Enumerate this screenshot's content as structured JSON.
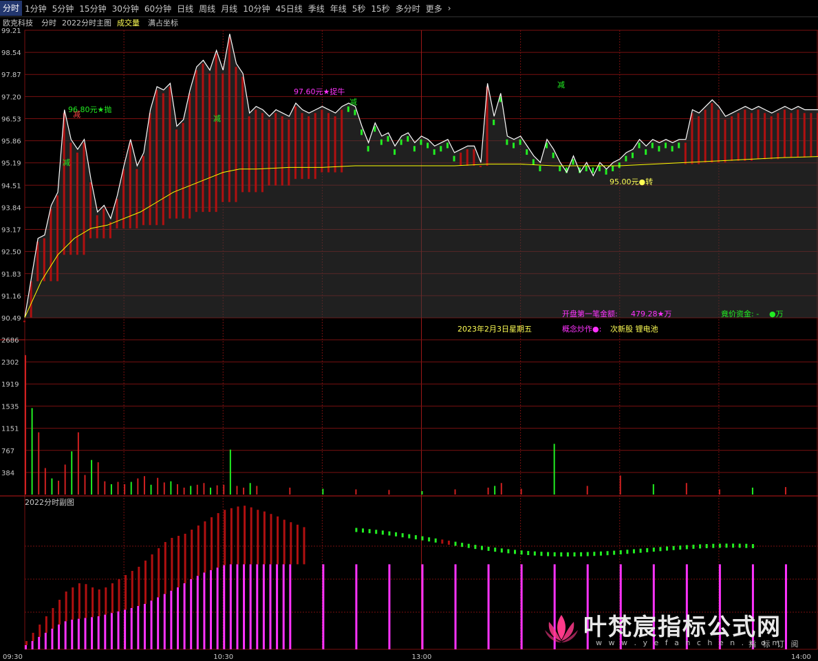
{
  "toolbar": {
    "items": [
      "分时",
      "1分钟",
      "5分钟",
      "15分钟",
      "30分钟",
      "60分钟",
      "日线",
      "周线",
      "月线",
      "10分钟",
      "45日线",
      "季线",
      "年线",
      "5秒",
      "15秒",
      "多分时",
      "更多"
    ],
    "active": "分时"
  },
  "header": {
    "stock": "欧克科技",
    "mode": "分时",
    "main": "2022分时主图",
    "vol": "成交量",
    "coord": "满占坐标"
  },
  "sub_title": "2022分时副图",
  "annotations": {
    "sell_price": "96.80元★抛",
    "buy_price": "97.60元★捉牛",
    "turn_price": "95.00元●转",
    "jian": "减",
    "date": "2023年2月3日星期五",
    "first_amount_label": "开盘第一笔金额:",
    "first_amount_value": "479.28★万",
    "auction_label": "竟价资金: -",
    "auction_value": "●万",
    "concept_label": "概念炒作●:",
    "concept_value": "次新股 锂电池"
  },
  "watermark": {
    "title": "叶梵宸指标公式网",
    "url": "w w w . y e f a n c h e n . c o m",
    "sub": "指 标 订 阅"
  },
  "colors": {
    "price": "#ffffff",
    "avg": "#ffff00",
    "red": "#b01010",
    "green": "#22ee22",
    "magenta": "#ff33ff",
    "grid": "#7a1010"
  },
  "chart_data": {
    "type": "line",
    "price_ticks": [
      "99.21",
      "98.54",
      "97.87",
      "97.20",
      "96.53",
      "95.86",
      "95.19",
      "94.51",
      "93.84",
      "93.17",
      "92.50",
      "91.83",
      "91.16",
      "90.49"
    ],
    "ylim": [
      90.49,
      99.21
    ],
    "volume_ticks": [
      "2686",
      "2302",
      "1919",
      "1535",
      "1151",
      "767",
      "384"
    ],
    "volume_lim": [
      0,
      2686
    ],
    "time_labels": [
      "09:30",
      "10:30",
      "13:00",
      "14:00"
    ],
    "price": {
      "x": [
        0,
        2,
        4,
        6,
        8,
        10,
        12,
        14,
        16,
        18,
        20,
        22,
        24,
        26,
        28,
        30,
        32,
        34,
        36,
        38,
        40,
        42,
        44,
        46,
        48,
        50,
        52,
        54,
        56,
        58,
        60,
        62,
        64,
        66,
        68,
        70,
        72,
        74,
        76,
        78,
        80,
        82,
        84,
        86,
        88,
        90,
        92,
        94,
        96,
        98,
        100,
        102,
        104,
        106,
        108,
        110,
        112,
        114,
        116,
        118,
        120,
        122,
        124,
        126,
        128,
        130,
        132,
        134,
        136,
        138,
        140,
        142,
        144,
        146,
        148,
        150,
        152,
        154,
        156,
        158,
        160,
        162,
        164,
        166,
        168,
        170,
        172,
        174,
        176,
        178,
        180,
        182,
        184,
        186,
        188,
        190,
        192,
        194,
        196,
        198,
        200,
        202,
        204,
        206,
        208,
        210,
        212,
        214,
        216,
        218,
        220,
        222,
        224,
        226,
        228,
        230,
        232,
        234,
        236,
        238,
        240
      ],
      "values": [
        90.5,
        91.7,
        92.9,
        93.0,
        93.9,
        94.3,
        96.8,
        95.9,
        95.6,
        95.9,
        94.7,
        93.7,
        93.9,
        93.5,
        94.2,
        95.1,
        95.9,
        95.1,
        95.5,
        96.8,
        97.5,
        97.4,
        97.6,
        96.3,
        96.5,
        97.4,
        98.1,
        98.3,
        98.0,
        98.6,
        98.0,
        99.1,
        98.2,
        97.9,
        96.7,
        96.9,
        96.8,
        96.6,
        96.8,
        96.7,
        96.6,
        97.0,
        96.8,
        96.7,
        96.8,
        96.9,
        96.8,
        96.7,
        96.9,
        97.0,
        96.9,
        96.3,
        95.8,
        96.4,
        96.0,
        96.1,
        95.7,
        96.0,
        96.1,
        95.8,
        96.0,
        95.9,
        95.7,
        95.8,
        95.9,
        95.5,
        95.6,
        95.7,
        95.7,
        95.2,
        97.6,
        96.6,
        97.3,
        96.0,
        95.9,
        96.0,
        95.7,
        95.4,
        95.2,
        95.9,
        95.6,
        95.2,
        94.9,
        95.4,
        94.9,
        95.2,
        94.8,
        95.2,
        95.0,
        95.2,
        95.3,
        95.5,
        95.6,
        95.9,
        95.7,
        95.9,
        95.8,
        95.9,
        95.8,
        95.9,
        95.9,
        96.8,
        96.7,
        96.9,
        97.1,
        96.9,
        96.6,
        96.7,
        96.8,
        96.9,
        96.8,
        96.9,
        96.8,
        96.7,
        96.8,
        96.9,
        96.8,
        96.9,
        96.8,
        96.8,
        96.8
      ]
    },
    "avg": {
      "x": [
        0,
        5,
        10,
        15,
        20,
        25,
        30,
        35,
        40,
        45,
        50,
        55,
        60,
        65,
        70,
        80,
        90,
        100,
        110,
        120,
        130,
        140,
        150,
        160,
        170,
        180,
        190,
        200,
        210,
        220,
        230,
        240
      ],
      "values": [
        90.5,
        91.6,
        92.4,
        92.9,
        93.2,
        93.3,
        93.5,
        93.7,
        94.0,
        94.3,
        94.5,
        94.7,
        94.9,
        95.0,
        95.0,
        95.05,
        95.05,
        95.1,
        95.1,
        95.1,
        95.1,
        95.15,
        95.15,
        95.1,
        95.1,
        95.1,
        95.15,
        95.2,
        95.25,
        95.3,
        95.35,
        95.38
      ]
    },
    "volume": {
      "x": [
        0,
        2,
        4,
        6,
        8,
        10,
        12,
        14,
        16,
        18,
        20,
        22,
        24,
        26,
        28,
        30,
        32,
        34,
        36,
        38,
        40,
        42,
        44,
        46,
        48,
        50,
        52,
        54,
        56,
        58,
        60,
        62,
        64,
        66,
        68,
        70,
        80,
        90,
        100,
        110,
        120,
        130,
        140,
        142,
        144,
        150,
        160,
        170,
        180,
        190,
        200,
        210,
        220,
        230,
        240
      ],
      "values": [
        2420,
        1500,
        1080,
        460,
        280,
        240,
        520,
        750,
        1080,
        340,
        600,
        560,
        230,
        180,
        220,
        180,
        220,
        280,
        320,
        170,
        290,
        210,
        230,
        180,
        120,
        150,
        170,
        200,
        120,
        160,
        170,
        780,
        150,
        120,
        200,
        150,
        120,
        100,
        90,
        80,
        60,
        90,
        120,
        150,
        200,
        100,
        880,
        150,
        330,
        180,
        200,
        90,
        120,
        130,
        80
      ]
    },
    "sub": {
      "red": [
        0,
        2,
        4,
        6,
        8,
        10,
        12,
        14,
        16,
        18,
        20,
        22,
        24,
        26,
        28,
        30,
        32,
        34,
        36,
        38,
        40,
        42,
        44,
        46,
        48,
        50,
        52,
        54,
        56,
        58,
        60,
        62,
        64,
        66,
        68,
        70,
        72,
        74,
        76,
        78,
        80,
        82,
        84
      ],
      "red_h": [
        20,
        40,
        60,
        80,
        100,
        120,
        140,
        150,
        160,
        158,
        150,
        145,
        150,
        160,
        170,
        180,
        190,
        200,
        215,
        230,
        245,
        260,
        270,
        275,
        280,
        290,
        300,
        310,
        320,
        330,
        338,
        342,
        346,
        348,
        344,
        338,
        334,
        328,
        322,
        314,
        308,
        302,
        296
      ],
      "mag": [
        0,
        2,
        4,
        6,
        8,
        10,
        12,
        14,
        16,
        18,
        20,
        22,
        24,
        26,
        28,
        30,
        32,
        34,
        36,
        38,
        40,
        42,
        44,
        46,
        48,
        50,
        52,
        54,
        56,
        58,
        60,
        62,
        64,
        66,
        68,
        70,
        72,
        74,
        76,
        78,
        80,
        90,
        100,
        110,
        120,
        130,
        140,
        150,
        160,
        170,
        180,
        190,
        200,
        210,
        220,
        230,
        240
      ],
      "mag_h": [
        10,
        20,
        30,
        40,
        50,
        60,
        68,
        72,
        74,
        76,
        78,
        80,
        84,
        88,
        92,
        96,
        100,
        105,
        110,
        118,
        126,
        134,
        142,
        150,
        160,
        170,
        178,
        186,
        192,
        198,
        204,
        206,
        206,
        206,
        206,
        206,
        206,
        206,
        206,
        206,
        206,
        206,
        206,
        206,
        206,
        206,
        206,
        206,
        206,
        206,
        206,
        206,
        206,
        206,
        206,
        206,
        206
      ]
    }
  }
}
